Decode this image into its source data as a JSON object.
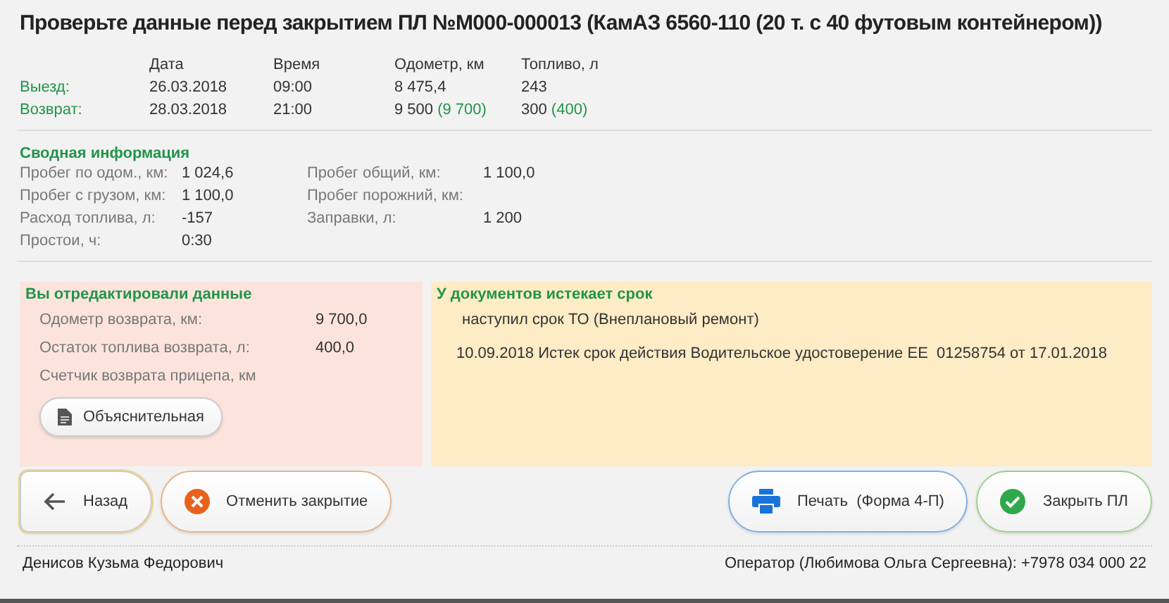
{
  "title": "Проверьте данные перед закрытием ПЛ №М000-000013 (КамАЗ 6560-110 (20 т. с 40 футовым контейнером))",
  "trip": {
    "columns": [
      "Дата",
      "Время",
      "Одометр, км",
      "Топливо, л"
    ],
    "rows": [
      {
        "label": "Выезд:",
        "cells": [
          {
            "value": "26.03.2018"
          },
          {
            "value": "09:00"
          },
          {
            "value": "8 475,4"
          },
          {
            "value": "243"
          }
        ]
      },
      {
        "label": "Возврат:",
        "cells": [
          {
            "value": "28.03.2018"
          },
          {
            "value": "21:00"
          },
          {
            "value": "9 500",
            "edited": "(9 700)"
          },
          {
            "value": "300",
            "edited": "(400)"
          }
        ]
      }
    ]
  },
  "summary": {
    "title": "Сводная информация",
    "rows": [
      [
        {
          "label": "Пробег по одом., км:",
          "value": "1 024,6"
        },
        {
          "label": "Пробег общий, км:",
          "value": "1 100,0"
        }
      ],
      [
        {
          "label": "Пробег с грузом, км:",
          "value": "1 100,0"
        },
        {
          "label": "Пробег порожний, км:"
        }
      ],
      [
        {
          "label": "Расход топлива, л:",
          "value": "-157"
        },
        {
          "label": "Заправки, л:",
          "value": "1 200"
        }
      ],
      [
        {
          "label": "Простои, ч:",
          "value": "0:30"
        }
      ]
    ]
  },
  "edited_panel": {
    "title": "Вы отредактировали данные",
    "rows": [
      {
        "label": "Одометр возврата, км:",
        "value": "9 700,0"
      },
      {
        "label": "Остаток топлива возврата, л:",
        "value": "400,0"
      },
      {
        "label": "Счетчик возврата прицепа, км"
      }
    ],
    "button": "Объяснительная"
  },
  "documents_panel": {
    "title": "У документов истекает срок",
    "items": [
      "наступил срок ТО (Внеплановый ремонт)",
      "10.09.2018 Истек срок действия Водительское удостоверение ЕЕ  01258754 от 17.01.2018"
    ]
  },
  "buttons_left": [
    {
      "kind": "back",
      "label": "Назад",
      "focused": true
    },
    {
      "kind": "cancel",
      "label": "Отменить закрытие",
      "focused": false
    }
  ],
  "buttons_right": [
    {
      "kind": "print",
      "label": "Печать  (Форма 4-П)",
      "focused": false
    },
    {
      "kind": "confirm",
      "label": "Закрыть ПЛ",
      "focused": false
    }
  ],
  "status_bar": {
    "driver": "Денисов Кузьма Федорович",
    "operator": "Оператор (Любимова Ольга Сергеевна): +7978 034 000 22"
  }
}
